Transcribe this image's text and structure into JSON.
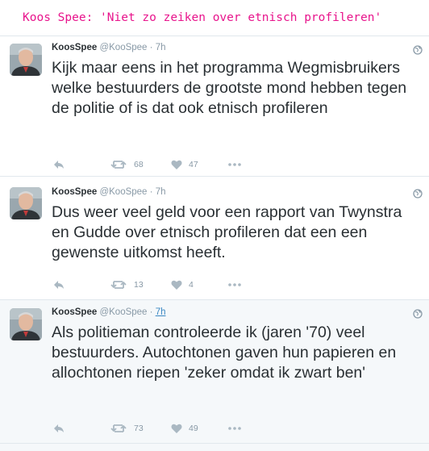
{
  "banner": {
    "title": "Koos Spee: 'Niet zo zeiken over etnisch profileren'"
  },
  "tweets": [
    {
      "name": "KoosSpee",
      "handle": "@KooSpee",
      "separator": "·",
      "time": "7h",
      "text": "Kijk maar eens in het programma Wegmisbruikers welke bestuurders de grootste mond hebben tegen de politie of is dat ook etnisch profileren",
      "retweets": "68",
      "likes": "47"
    },
    {
      "name": "KoosSpee",
      "handle": "@KooSpee",
      "separator": "·",
      "time": "7h",
      "text": "Dus weer veel geld voor een rapport van Twynstra en Gudde over etnisch profileren dat een een gewenste uitkomst heeft.",
      "retweets": "13",
      "likes": "4"
    },
    {
      "name": "KoosSpee",
      "handle": "@KooSpee",
      "separator": "·",
      "time": "7h",
      "text": "Als politieman controleerde ik (jaren '70) veel bestuurders. Autochtonen gaven hun papieren en allochtonen riepen 'zeker omdat ik zwart ben'",
      "retweets": "73",
      "likes": "49"
    }
  ],
  "icons": {
    "reply": "reply-icon",
    "retweet": "retweet-icon",
    "like": "heart-icon",
    "more": "more-dots-icon",
    "globe": "globe-icon"
  },
  "colors": {
    "banner_text": "#e8148c",
    "text": "#292f33",
    "muted": "#8899a6",
    "border": "#e1e8ed",
    "highlight_bg": "#f5f8fa",
    "link": "#3b88c3"
  }
}
